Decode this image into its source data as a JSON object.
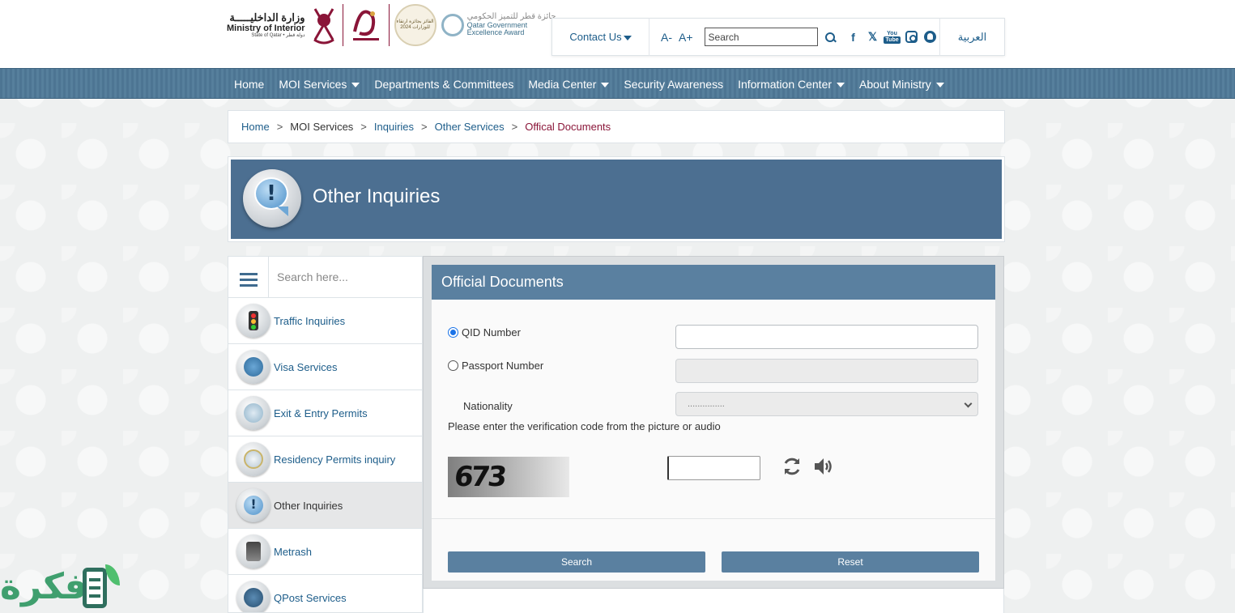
{
  "header": {
    "logo": {
      "ministry_ar": "وزارة الداخليـــــة",
      "ministry_en": "Ministry of Interior",
      "state": "State of Qatar • دولة قطر",
      "award_ar": "جائزة قطر للتميز الحكومي",
      "award_en1": "Qatar Government",
      "award_en2": "Excellence Award",
      "round_text": "الفائز بجائزة ارتقاء للوزارات 2024"
    },
    "contact_label": "Contact Us",
    "font_decrease": "A-",
    "font_increase": "A+",
    "search_placeholder": "Search",
    "language_label": "العربية",
    "social": {
      "facebook": "f",
      "x": "𝕏",
      "youtube_top": "You",
      "youtube_bottom": "Tube"
    }
  },
  "nav": {
    "items": [
      {
        "label": "Home"
      },
      {
        "label": "MOI Services"
      },
      {
        "label": "Departments & Committees"
      },
      {
        "label": "Media Center"
      },
      {
        "label": "Security Awareness"
      },
      {
        "label": "Information Center"
      },
      {
        "label": "About Ministry"
      }
    ]
  },
  "breadcrumb": {
    "items": [
      "Home",
      "MOI Services",
      "Inquiries",
      "Other Services"
    ],
    "current": "Offical Documents",
    "separator": ">"
  },
  "banner": {
    "title": "Other Inquiries"
  },
  "sidebar": {
    "search_placeholder": "Search here...",
    "items": [
      {
        "label": "Traffic Inquiries"
      },
      {
        "label": "Visa Services"
      },
      {
        "label": "Exit & Entry Permits"
      },
      {
        "label": "Residency Permits inquiry"
      },
      {
        "label": "Other Inquiries"
      },
      {
        "label": "Metrash"
      },
      {
        "label": "QPost Services"
      }
    ]
  },
  "form": {
    "title": "Official Documents",
    "qid_label": "QID Number",
    "qid_value": "",
    "passport_label": "Passport Number",
    "passport_value": "",
    "nationality_label": "Nationality",
    "nationality_selected": "...............",
    "verification_text": "Please enter the verification code from the picture or audio",
    "captcha_code": "673",
    "captcha_value": "",
    "search_button": "Search",
    "reset_button": "Reset"
  },
  "watermark": {
    "text": "فكرة"
  },
  "colors": {
    "nav_bg": "#567f9c",
    "panel_head": "#5a80a0",
    "banner_bg": "#4c6f91",
    "link": "#1d5d8a",
    "current_crumb": "#8a1538"
  }
}
